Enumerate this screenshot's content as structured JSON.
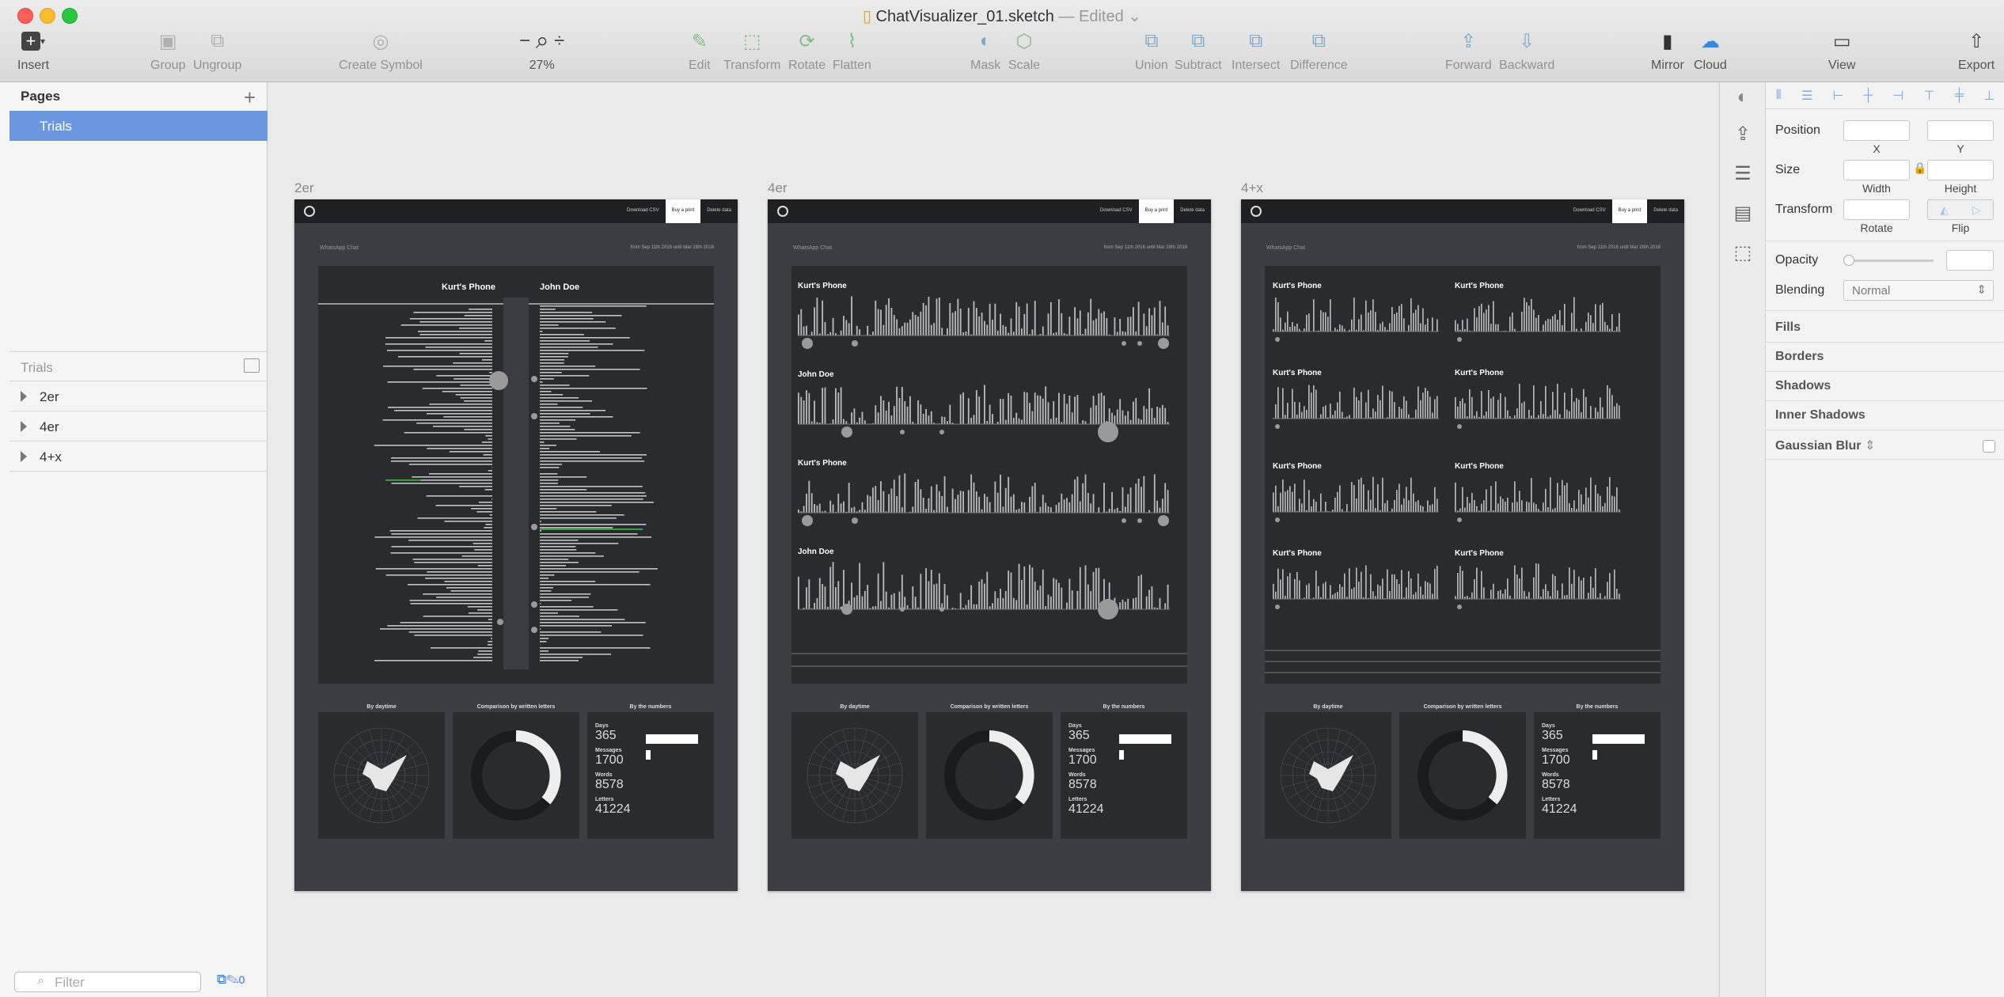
{
  "window": {
    "file": "ChatVisualizer_01.sketch",
    "status": "— Edited"
  },
  "toolbar": {
    "insert": "Insert",
    "group": "Group",
    "ungroup": "Ungroup",
    "create_symbol": "Create Symbol",
    "zoom": "27%",
    "edit": "Edit",
    "transform": "Transform",
    "rotate": "Rotate",
    "flatten": "Flatten",
    "mask": "Mask",
    "scale": "Scale",
    "union": "Union",
    "subtract": "Subtract",
    "intersect": "Intersect",
    "difference": "Difference",
    "forward": "Forward",
    "backward": "Backward",
    "mirror": "Mirror",
    "cloud": "Cloud",
    "view": "View",
    "export": "Export"
  },
  "pages": {
    "heading": "Pages",
    "items": [
      "Trials"
    ]
  },
  "layers": {
    "heading": "Trials",
    "items": [
      "2er",
      "4er",
      "4+x"
    ]
  },
  "filter": {
    "placeholder": "Filter",
    "count": "0"
  },
  "artboards": [
    {
      "label": "2er",
      "variant": "two"
    },
    {
      "label": "4er",
      "variant": "four"
    },
    {
      "label": "4+x",
      "variant": "grid"
    }
  ],
  "artboard_content": {
    "title": "WhatsApp Chat",
    "date_range": "from Sep 11th 2016 until Mar 28th 2018",
    "nav": [
      "Download CSV",
      "Buy a print",
      "Delete data"
    ],
    "person_a": "Kurt's Phone",
    "person_b": "John Doe",
    "card_titles": [
      "By daytime",
      "Comparison by written letters",
      "By the numbers"
    ],
    "numbers": [
      {
        "key": "Days",
        "value": "365"
      },
      {
        "key": "Messages",
        "value": "1700"
      },
      {
        "key": "Words",
        "value": "8578"
      },
      {
        "key": "Letters",
        "value": "41224"
      }
    ]
  },
  "inspector": {
    "position": "Position",
    "x": "X",
    "y": "Y",
    "size": "Size",
    "width": "Width",
    "height": "Height",
    "transform": "Transform",
    "rotate": "Rotate",
    "flip": "Flip",
    "opacity": "Opacity",
    "blending": "Blending",
    "blending_value": "Normal",
    "sections": [
      "Fills",
      "Borders",
      "Shadows",
      "Inner Shadows",
      "Gaussian Blur"
    ]
  }
}
